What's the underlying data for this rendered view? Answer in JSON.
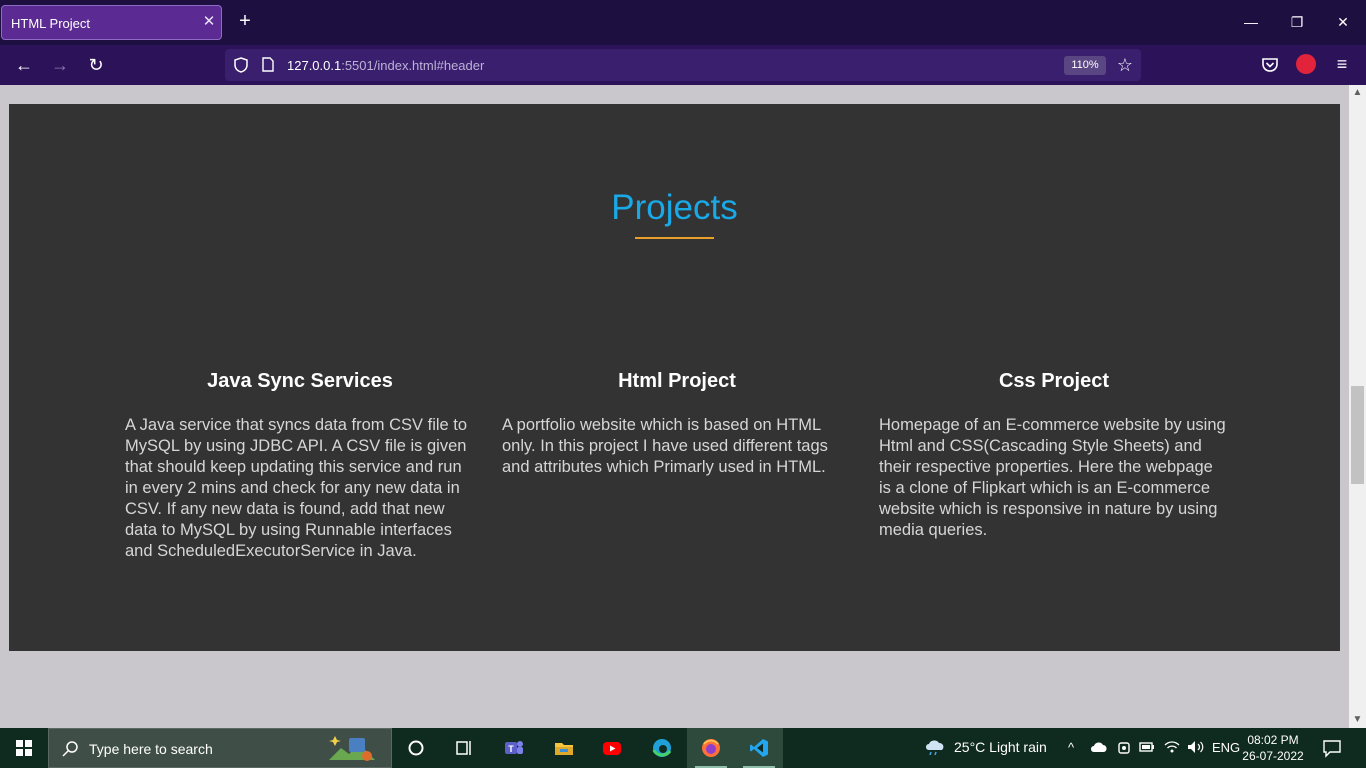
{
  "browser": {
    "tab_title": "HTML Project",
    "tab_close": "✕",
    "new_tab": "+",
    "url_host": "127.0.0.1",
    "url_rest": ":5501/index.html#header",
    "zoom": "110%",
    "window_controls": {
      "minimize": "—",
      "restore": "❐",
      "close": "✕"
    },
    "nav": {
      "back": "←",
      "forward": "→",
      "reload": "↻",
      "bookmark": "☆",
      "menu": "≡"
    },
    "icons": [
      "shield-icon",
      "page-icon",
      "pocket-icon",
      "extension-icon"
    ]
  },
  "page": {
    "section_title": "Projects",
    "colors": {
      "section_bg": "#333333",
      "title": "#19a9e6",
      "underline": "#e8a02a",
      "page_bg": "#c9c7cc"
    },
    "projects": [
      {
        "title": "Java Sync Services",
        "description": "A Java service that syncs data from CSV file to MySQL by using JDBC API. A CSV file is given that should keep updating this service and run in every 2 mins and check for any new data in CSV. If any new data is found, add that new data to MySQL by using Runnable interfaces and ScheduledExecutorService in Java."
      },
      {
        "title": "Html Project",
        "description": "A portfolio website which is based on HTML only. In this project I have used different tags and attributes which Primarly used in HTML."
      },
      {
        "title": "Css Project",
        "description": "Homepage of an E-commerce website by using Html and CSS(Cascading Style Sheets) and their respective properties. Here the webpage is a clone of Flipkart which is an E-commerce website which is responsive in nature by using media queries."
      }
    ]
  },
  "scrollbar": {
    "up": "▲",
    "down": "▼"
  },
  "taskbar": {
    "search_placeholder": "Type here to search",
    "weather": "25°C  Light rain",
    "tray_chevron": "^",
    "language": "ENG",
    "time": "08:02 PM",
    "date": "26-07-2022",
    "apps": [
      "cortana-icon",
      "task-view-icon",
      "teams-icon",
      "file-explorer-icon",
      "youtube-icon",
      "edge-icon",
      "firefox-icon",
      "vscode-icon"
    ]
  }
}
